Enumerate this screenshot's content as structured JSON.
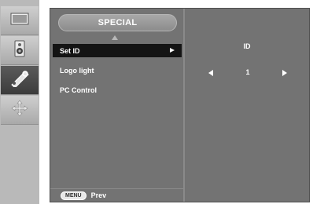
{
  "sidebar": {
    "icons": [
      {
        "name": "picture-icon"
      },
      {
        "name": "audio-icon"
      },
      {
        "name": "special-icon",
        "active": true
      },
      {
        "name": "position-icon"
      }
    ]
  },
  "osd": {
    "title": "SPECIAL",
    "items": [
      {
        "label": "Set ID"
      },
      {
        "label": "Logo light"
      },
      {
        "label": "PC Control"
      }
    ],
    "footer": {
      "key": "MENU",
      "label": "Prev"
    },
    "setting": {
      "label": "ID",
      "value": "1"
    }
  },
  "colors": {
    "osd_bg": "#737373",
    "selected_bg": "#141414",
    "sidebar_bg": "#b9b9b9"
  }
}
